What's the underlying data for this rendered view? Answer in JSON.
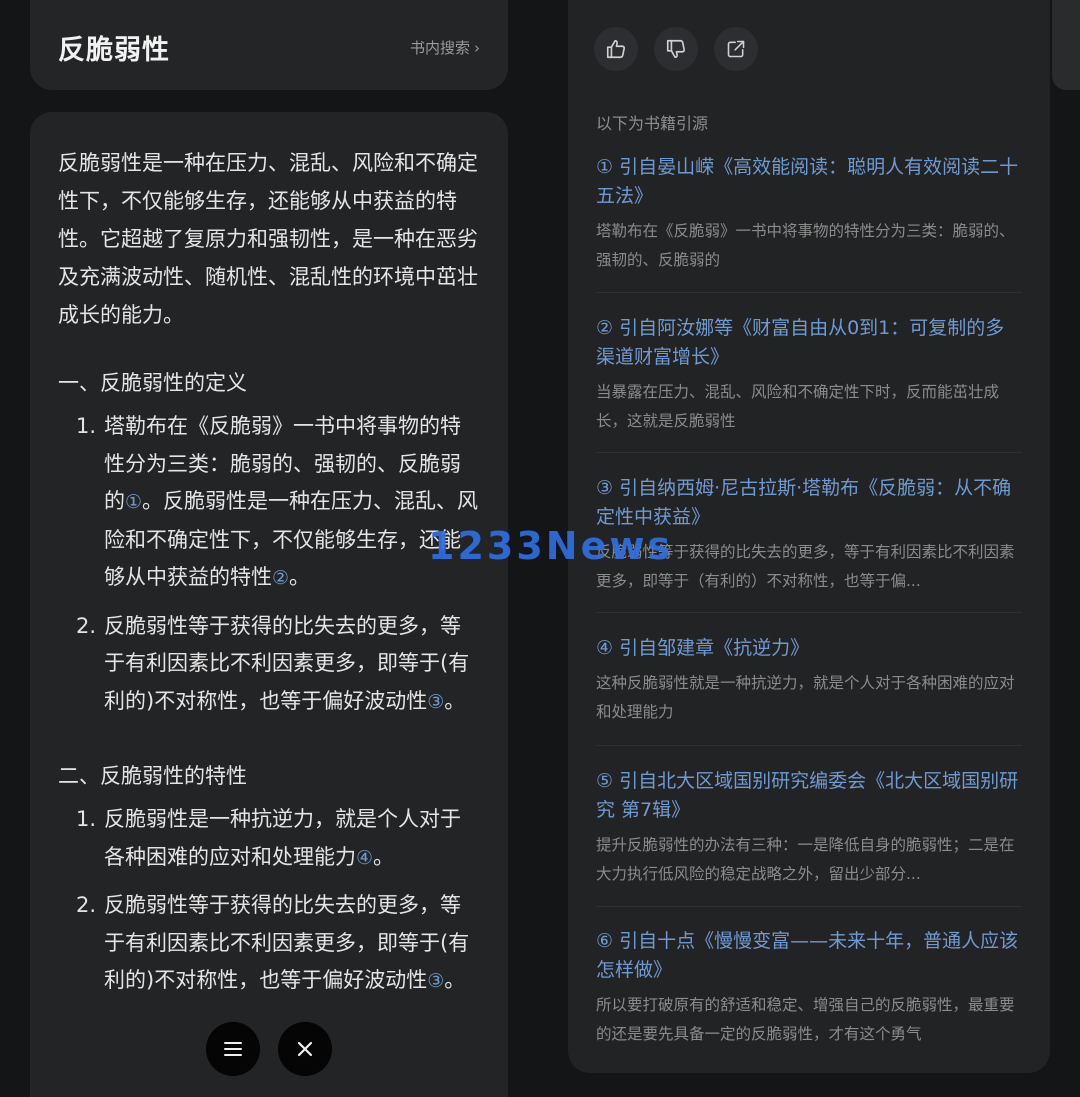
{
  "left": {
    "title": "反脆弱性",
    "search_link": "书内搜索",
    "intro": "反脆弱性是一种在压力、混乱、风险和不确定性下，不仅能够生存，还能够从中获益的特性。它超越了复原力和强韧性，是一种在恶劣及充满波动性、随机性、混乱性的环境中茁壮成长的能力。",
    "section1": {
      "heading": "一、反脆弱性的定义",
      "items": [
        {
          "num": "1.",
          "text": "塔勒布在《反脆弱》一书中将事物的特性分为三类：脆弱的、强韧的、反脆弱的",
          "cite": "①",
          "text2": "。反脆弱性是一种在压力、混乱、风险和不确定性下，不仅能够生存，还能够从中获益的特性",
          "cite2": "②",
          "text3": "。"
        },
        {
          "num": "2.",
          "text": "反脆弱性等于获得的比失去的更多，等于有利因素比不利因素更多，即等于(有利的)不对称性，也等于偏好波动性",
          "cite": "③",
          "text2": "。"
        }
      ]
    },
    "section2": {
      "heading": "二、反脆弱性的特性",
      "items": [
        {
          "num": "1.",
          "text": "反脆弱性是一种抗逆力，就是个人对于各种困难的应对和处理能力",
          "cite": "④",
          "text2": "。"
        },
        {
          "num": "2.",
          "text": "反脆弱性等于获得的比失去的更多，等于有利因素比不利因素更多，即等于(有利的)不对称性，也等于偏好波动性",
          "cite": "③",
          "text2": "。"
        }
      ]
    }
  },
  "watermark": "1233News",
  "right": {
    "sources_label": "以下为书籍引源",
    "sources": [
      {
        "title": "① 引自晏山嵘《高效能阅读：聪明人有效阅读二十五法》",
        "snippet": "塔勒布在《反脆弱》一书中将事物的特性分为三类：脆弱的、强韧的、反脆弱的"
      },
      {
        "title": "② 引自阿汝娜等《财富自由从0到1：可复制的多渠道财富增长》",
        "snippet": "当暴露在压力、混乱、风险和不确定性下时，反而能茁壮成长，这就是反脆弱性"
      },
      {
        "title": "③ 引自纳西姆·尼古拉斯·塔勒布《反脆弱：从不确定性中获益》",
        "snippet": "反脆弱性等于获得的比失去的更多，等于有利因素比不利因素更多，即等于（有利的）不对称性，也等于偏..."
      },
      {
        "title": "④ 引自邹建章《抗逆力》",
        "snippet": "这种反脆弱性就是一种抗逆力，就是个人对于各种困难的应对和处理能力"
      },
      {
        "title": "⑤ 引自北大区域国别研究编委会《北大区域国别研究 第7辑》",
        "snippet": "提升反脆弱性的办法有三种：一是降低自身的脆弱性；二是在大力执行低风险的稳定战略之外，留出少部分..."
      },
      {
        "title": "⑥ 引自十点《慢慢变富——未来十年，普通人应该怎样做》",
        "snippet": "所以要打破原有的舒适和稳定、增强自己的反脆弱性，最重要的还是要先具备一定的反脆弱性，才有这个勇气"
      }
    ]
  },
  "icons": {
    "like": "thumbs-up-icon",
    "dislike": "thumbs-down-icon",
    "share": "share-icon",
    "menu": "menu-icon",
    "close": "close-icon"
  }
}
